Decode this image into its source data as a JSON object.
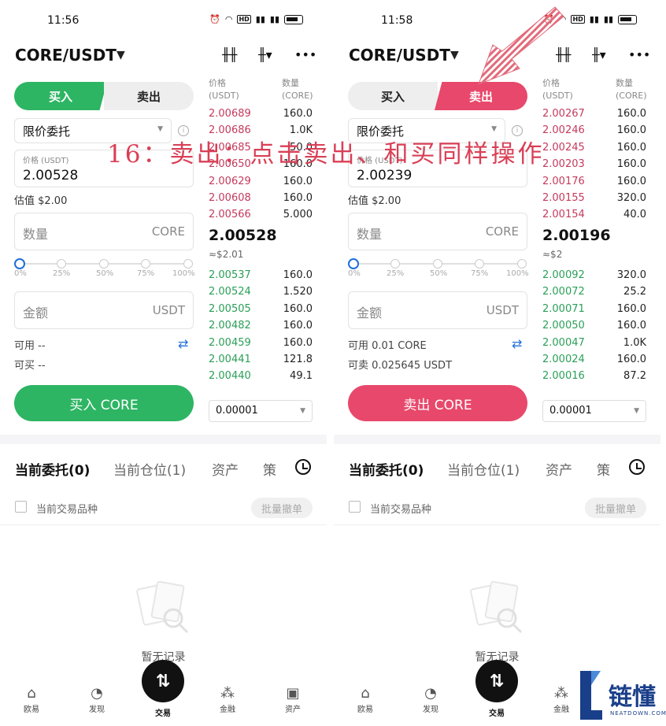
{
  "caption": "16：卖出：点击卖出、和买同样操作",
  "brand": {
    "name": "链懂",
    "sub": "NEATDOWN.COM"
  },
  "colors": {
    "buy": "#2db563",
    "sell": "#e8486b",
    "ask": "#c43a5c",
    "bid": "#2a9f57",
    "link": "#1f6fd8"
  },
  "left": {
    "status": {
      "time": "11:56"
    },
    "pair": "CORE/USDT",
    "tabs": {
      "buy": "买入",
      "sell": "卖出"
    },
    "order_type": "限价委托",
    "price_label": "价格 (USDT)",
    "price_value": "2.00528",
    "estimate": "估值 $2.00",
    "qty_placeholder": "数量",
    "qty_unit": "CORE",
    "percents": [
      "0%",
      "25%",
      "50%",
      "75%",
      "100%"
    ],
    "amount_placeholder": "金额",
    "amount_unit": "USDT",
    "available": "可用 --",
    "can_trade": "可买 --",
    "action": "买入 CORE",
    "orderbook": {
      "price_header": "价格",
      "price_unit": "(USDT)",
      "qty_header": "数量",
      "qty_unit": "(CORE)",
      "asks": [
        {
          "p": "2.00689",
          "q": "160.0"
        },
        {
          "p": "2.00686",
          "q": "1.0K"
        },
        {
          "p": "2.00685",
          "q": "50.0"
        },
        {
          "p": "2.00650",
          "q": "160.0"
        },
        {
          "p": "2.00629",
          "q": "160.0"
        },
        {
          "p": "2.00608",
          "q": "160.0"
        },
        {
          "p": "2.00566",
          "q": "5.000"
        }
      ],
      "last": "2.00528",
      "last_usd": "≈$2.01",
      "bids": [
        {
          "p": "2.00537",
          "q": "160.0"
        },
        {
          "p": "2.00524",
          "q": "1.520"
        },
        {
          "p": "2.00505",
          "q": "160.0"
        },
        {
          "p": "2.00482",
          "q": "160.0"
        },
        {
          "p": "2.00459",
          "q": "160.0"
        },
        {
          "p": "2.00441",
          "q": "121.8"
        },
        {
          "p": "2.00440",
          "q": "49.1"
        }
      ],
      "tick": "0.00001"
    }
  },
  "right": {
    "status": {
      "time": "11:58"
    },
    "pair": "CORE/USDT",
    "tabs": {
      "buy": "买入",
      "sell": "卖出"
    },
    "order_type": "限价委托",
    "price_label": "价格 (USDT)",
    "price_value": "2.00239",
    "estimate": "估值 $2.00",
    "qty_placeholder": "数量",
    "qty_unit": "CORE",
    "percents": [
      "0%",
      "25%",
      "50%",
      "75%",
      "100%"
    ],
    "amount_placeholder": "金额",
    "amount_unit": "USDT",
    "available": "可用 0.01 CORE",
    "can_trade": "可卖 0.025645 USDT",
    "action": "卖出 CORE",
    "orderbook": {
      "price_header": "价格",
      "price_unit": "(USDT)",
      "qty_header": "数量",
      "qty_unit": "(CORE)",
      "asks": [
        {
          "p": "2.00267",
          "q": "160.0"
        },
        {
          "p": "2.00246",
          "q": "160.0"
        },
        {
          "p": "2.00245",
          "q": "160.0"
        },
        {
          "p": "2.00203",
          "q": "160.0"
        },
        {
          "p": "2.00176",
          "q": "160.0"
        },
        {
          "p": "2.00155",
          "q": "320.0"
        },
        {
          "p": "2.00154",
          "q": "40.0"
        }
      ],
      "last": "2.00196",
      "last_usd": "≈$2",
      "bids": [
        {
          "p": "2.00092",
          "q": "320.0"
        },
        {
          "p": "2.00072",
          "q": "25.2"
        },
        {
          "p": "2.00071",
          "q": "160.0"
        },
        {
          "p": "2.00050",
          "q": "160.0"
        },
        {
          "p": "2.00047",
          "q": "1.0K"
        },
        {
          "p": "2.00024",
          "q": "160.0"
        },
        {
          "p": "2.00016",
          "q": "87.2"
        }
      ],
      "tick": "0.00001"
    }
  },
  "bottom_tabs": [
    "当前委托(0)",
    "当前仓位(1)",
    "资产",
    "策"
  ],
  "filter_label": "当前交易品种",
  "cancel_all": "批量撤单",
  "empty": "暂无记录",
  "nav": [
    "欧易",
    "发现",
    "交易",
    "金融",
    "资产"
  ],
  "icons": [
    "alarm-icon",
    "wifi-icon",
    "battery-icon",
    "candlestick-icon",
    "indicator-icon",
    "more-icon",
    "info-icon",
    "swap-icon",
    "history-clock-icon",
    "empty-doc-icon",
    "home-icon",
    "discover-icon",
    "trade-icon",
    "finance-icon",
    "wallet-icon"
  ]
}
